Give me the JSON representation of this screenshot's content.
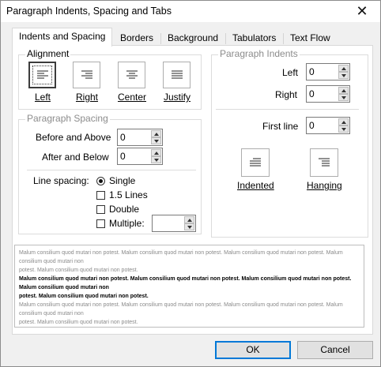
{
  "window": {
    "title": "Paragraph Indents, Spacing and Tabs",
    "close_glyph": "✕"
  },
  "tabs": [
    {
      "label": "Indents and Spacing",
      "active": true
    },
    {
      "label": "Borders",
      "active": false
    },
    {
      "label": "Background",
      "active": false
    },
    {
      "label": "Tabulators",
      "active": false
    },
    {
      "label": "Text Flow",
      "active": false
    }
  ],
  "alignment": {
    "title": "Alignment",
    "options": [
      {
        "label": "Left",
        "icon": "align-left-icon",
        "selected": true
      },
      {
        "label": "Right",
        "icon": "align-right-icon",
        "selected": false
      },
      {
        "label": "Center",
        "icon": "align-center-icon",
        "selected": false
      },
      {
        "label": "Justify",
        "icon": "align-justify-icon",
        "selected": false
      }
    ]
  },
  "paragraph_spacing": {
    "title": "Paragraph Spacing",
    "before_label": "Before and Above",
    "before_value": "0",
    "after_label": "After and Below",
    "after_value": "0",
    "line_spacing_label": "Line spacing:",
    "line_options": [
      {
        "label": "Single",
        "type": "radio",
        "checked": true
      },
      {
        "label": "1.5 Lines",
        "type": "checkbox",
        "checked": false
      },
      {
        "label": "Double",
        "type": "checkbox",
        "checked": false
      },
      {
        "label": "Multiple:",
        "type": "checkbox",
        "checked": false
      }
    ],
    "multiple_value": ""
  },
  "paragraph_indents": {
    "title": "Paragraph Indents",
    "left_label": "Left",
    "left_value": "0",
    "right_label": "Right",
    "right_value": "0",
    "first_line_label": "First line",
    "first_line_value": "0",
    "indented_label": "Indented",
    "hanging_label": "Hanging"
  },
  "preview": {
    "lines": [
      {
        "text": "Malum consilium quod mutari non potest. Malum consilium quod mutari non potest. Malum consilium quod mutari non potest. Malum consilium quod mutari non",
        "style": "gray"
      },
      {
        "text": "potest. Malum consilium quod mutari non potest.",
        "style": "gray"
      },
      {
        "text": "Malum consilium quod mutari non potest. Malum consilium quod mutari non potest. Malum consilium quod mutari non potest. Malum consilium quod mutari non",
        "style": "bold"
      },
      {
        "text": "potest. Malum consilium quod mutari non potest.",
        "style": "bold"
      },
      {
        "text": "Malum consilium quod mutari non potest. Malum consilium quod mutari non potest. Malum consilium quod mutari non potest. Malum consilium quod mutari non",
        "style": "gray"
      },
      {
        "text": "potest. Malum consilium quod mutari non potest.",
        "style": "gray"
      }
    ]
  },
  "buttons": {
    "ok": "OK",
    "cancel": "Cancel"
  }
}
